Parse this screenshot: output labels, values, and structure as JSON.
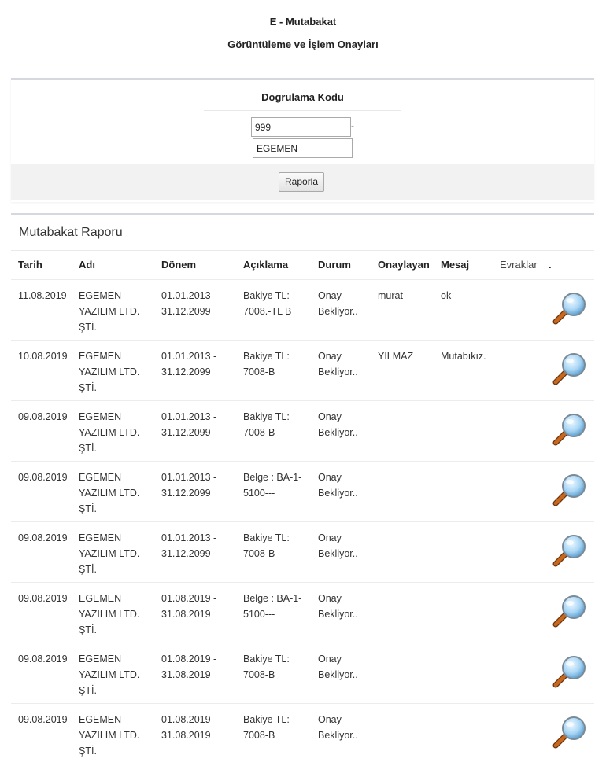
{
  "header": {
    "title": "E - Mutabakat",
    "subtitle": "Görüntüleme ve İşlem Onayları"
  },
  "verify": {
    "title": "Dogrulama Kodu",
    "code_value": "999",
    "separator": "-",
    "name_value": "EGEMEN",
    "button_label": "Raporla"
  },
  "report": {
    "title": "Mutabakat Raporu",
    "columns": {
      "date": "Tarih",
      "name": "Adı",
      "period": "Dönem",
      "description": "Açıklama",
      "status": "Durum",
      "approver": "Onaylayan",
      "message": "Mesaj",
      "documents": "Evraklar",
      "dot": "."
    },
    "rows": [
      {
        "date": "11.08.2019",
        "name": "EGEMEN YAZILIM LTD. ŞTİ.",
        "period": "01.01.2013 - 31.12.2099",
        "description": "Bakiye TL: 7008.-TL B",
        "status": "Onay Bekliyor..",
        "approver": "murat",
        "message": "ok",
        "icon": "magnifier-icon"
      },
      {
        "date": "10.08.2019",
        "name": "EGEMEN YAZILIM LTD. ŞTİ.",
        "period": "01.01.2013 - 31.12.2099",
        "description": "Bakiye TL: 7008-B",
        "status": "Onay Bekliyor..",
        "approver": "YILMAZ",
        "message": "Mutabıkız.",
        "icon": "magnifier-icon"
      },
      {
        "date": "09.08.2019",
        "name": "EGEMEN YAZILIM LTD. ŞTİ.",
        "period": "01.01.2013 - 31.12.2099",
        "description": "Bakiye TL: 7008-B",
        "status": "Onay Bekliyor..",
        "approver": "",
        "message": "",
        "icon": "magnifier-icon"
      },
      {
        "date": "09.08.2019",
        "name": "EGEMEN YAZILIM LTD. ŞTİ.",
        "period": "01.01.2013 - 31.12.2099",
        "description": "Belge : BA-1-5100---",
        "status": "Onay Bekliyor..",
        "approver": "",
        "message": "",
        "icon": "magnifier-icon"
      },
      {
        "date": "09.08.2019",
        "name": "EGEMEN YAZILIM LTD. ŞTİ.",
        "period": "01.01.2013 - 31.12.2099",
        "description": "Bakiye TL: 7008-B",
        "status": "Onay Bekliyor..",
        "approver": "",
        "message": "",
        "icon": "magnifier-icon"
      },
      {
        "date": "09.08.2019",
        "name": "EGEMEN YAZILIM LTD. ŞTİ.",
        "period": "01.08.2019 - 31.08.2019",
        "description": "Belge : BA-1-5100---",
        "status": "Onay Bekliyor..",
        "approver": "",
        "message": "",
        "icon": "magnifier-icon"
      },
      {
        "date": "09.08.2019",
        "name": "EGEMEN YAZILIM LTD. ŞTİ.",
        "period": "01.08.2019 - 31.08.2019",
        "description": "Bakiye TL: 7008-B",
        "status": "Onay Bekliyor..",
        "approver": "",
        "message": "",
        "icon": "magnifier-icon"
      },
      {
        "date": "09.08.2019",
        "name": "EGEMEN YAZILIM LTD. ŞTİ.",
        "period": "01.08.2019 - 31.08.2019",
        "description": "Bakiye TL: 7008-B",
        "status": "Onay Bekliyor..",
        "approver": "",
        "message": "",
        "icon": "magnifier-icon"
      }
    ]
  },
  "colors": {
    "panel_border": "#d5d8dd",
    "footer_bg": "#f2f2f2",
    "lens_blue": "#a9d6f5",
    "handle_orange": "#c8671e"
  }
}
